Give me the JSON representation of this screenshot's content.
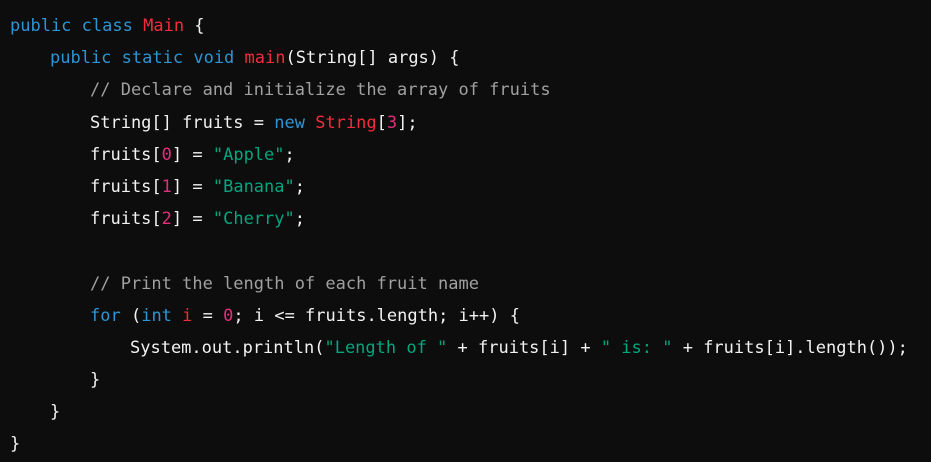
{
  "theme": {
    "background": "#0d0d0d",
    "colors": {
      "plain": "#f2f2f2",
      "keyword": "#2e95d3",
      "classname": "#f22c3d",
      "comment": "#a0a0a0",
      "string": "#00a67d",
      "number": "#df3079"
    }
  },
  "code": {
    "language": "java",
    "lines": [
      {
        "indent": 0,
        "tokens": [
          {
            "t": "keyword",
            "v": "public"
          },
          {
            "t": "plain",
            "v": " "
          },
          {
            "t": "keyword",
            "v": "class"
          },
          {
            "t": "plain",
            "v": " "
          },
          {
            "t": "classname",
            "v": "Main"
          },
          {
            "t": "plain",
            "v": " {"
          }
        ]
      },
      {
        "indent": 1,
        "tokens": [
          {
            "t": "keyword",
            "v": "public"
          },
          {
            "t": "plain",
            "v": " "
          },
          {
            "t": "keyword",
            "v": "static"
          },
          {
            "t": "plain",
            "v": " "
          },
          {
            "t": "keyword",
            "v": "void"
          },
          {
            "t": "plain",
            "v": " "
          },
          {
            "t": "classname",
            "v": "main"
          },
          {
            "t": "plain",
            "v": "(String[] args) {"
          }
        ]
      },
      {
        "indent": 2,
        "tokens": [
          {
            "t": "comment",
            "v": "// Declare and initialize the array of fruits"
          }
        ]
      },
      {
        "indent": 2,
        "tokens": [
          {
            "t": "plain",
            "v": "String[] fruits = "
          },
          {
            "t": "keyword",
            "v": "new"
          },
          {
            "t": "plain",
            "v": " "
          },
          {
            "t": "classname",
            "v": "String"
          },
          {
            "t": "plain",
            "v": "["
          },
          {
            "t": "number",
            "v": "3"
          },
          {
            "t": "plain",
            "v": "];"
          }
        ]
      },
      {
        "indent": 2,
        "tokens": [
          {
            "t": "plain",
            "v": "fruits["
          },
          {
            "t": "number",
            "v": "0"
          },
          {
            "t": "plain",
            "v": "] = "
          },
          {
            "t": "string",
            "v": "\"Apple\""
          },
          {
            "t": "plain",
            "v": ";"
          }
        ]
      },
      {
        "indent": 2,
        "tokens": [
          {
            "t": "plain",
            "v": "fruits["
          },
          {
            "t": "number",
            "v": "1"
          },
          {
            "t": "plain",
            "v": "] = "
          },
          {
            "t": "string",
            "v": "\"Banana\""
          },
          {
            "t": "plain",
            "v": ";"
          }
        ]
      },
      {
        "indent": 2,
        "tokens": [
          {
            "t": "plain",
            "v": "fruits["
          },
          {
            "t": "number",
            "v": "2"
          },
          {
            "t": "plain",
            "v": "] = "
          },
          {
            "t": "string",
            "v": "\"Cherry\""
          },
          {
            "t": "plain",
            "v": ";"
          }
        ]
      },
      {
        "indent": 0,
        "tokens": []
      },
      {
        "indent": 2,
        "tokens": [
          {
            "t": "comment",
            "v": "// Print the length of each fruit name"
          }
        ]
      },
      {
        "indent": 2,
        "tokens": [
          {
            "t": "keyword",
            "v": "for"
          },
          {
            "t": "plain",
            "v": " ("
          },
          {
            "t": "keyword",
            "v": "int"
          },
          {
            "t": "plain",
            "v": " "
          },
          {
            "t": "classname",
            "v": "i"
          },
          {
            "t": "plain",
            "v": " = "
          },
          {
            "t": "number",
            "v": "0"
          },
          {
            "t": "plain",
            "v": "; i <= fruits.length; i++) {"
          }
        ]
      },
      {
        "indent": 3,
        "tokens": [
          {
            "t": "plain",
            "v": "System.out.println("
          },
          {
            "t": "string",
            "v": "\"Length of \""
          },
          {
            "t": "plain",
            "v": " + fruits[i] + "
          },
          {
            "t": "string",
            "v": "\" is: \""
          },
          {
            "t": "plain",
            "v": " + fruits[i].length());"
          }
        ]
      },
      {
        "indent": 2,
        "tokens": [
          {
            "t": "plain",
            "v": "}"
          }
        ]
      },
      {
        "indent": 1,
        "tokens": [
          {
            "t": "plain",
            "v": "}"
          }
        ]
      },
      {
        "indent": 0,
        "tokens": [
          {
            "t": "plain",
            "v": "}"
          }
        ]
      }
    ]
  }
}
